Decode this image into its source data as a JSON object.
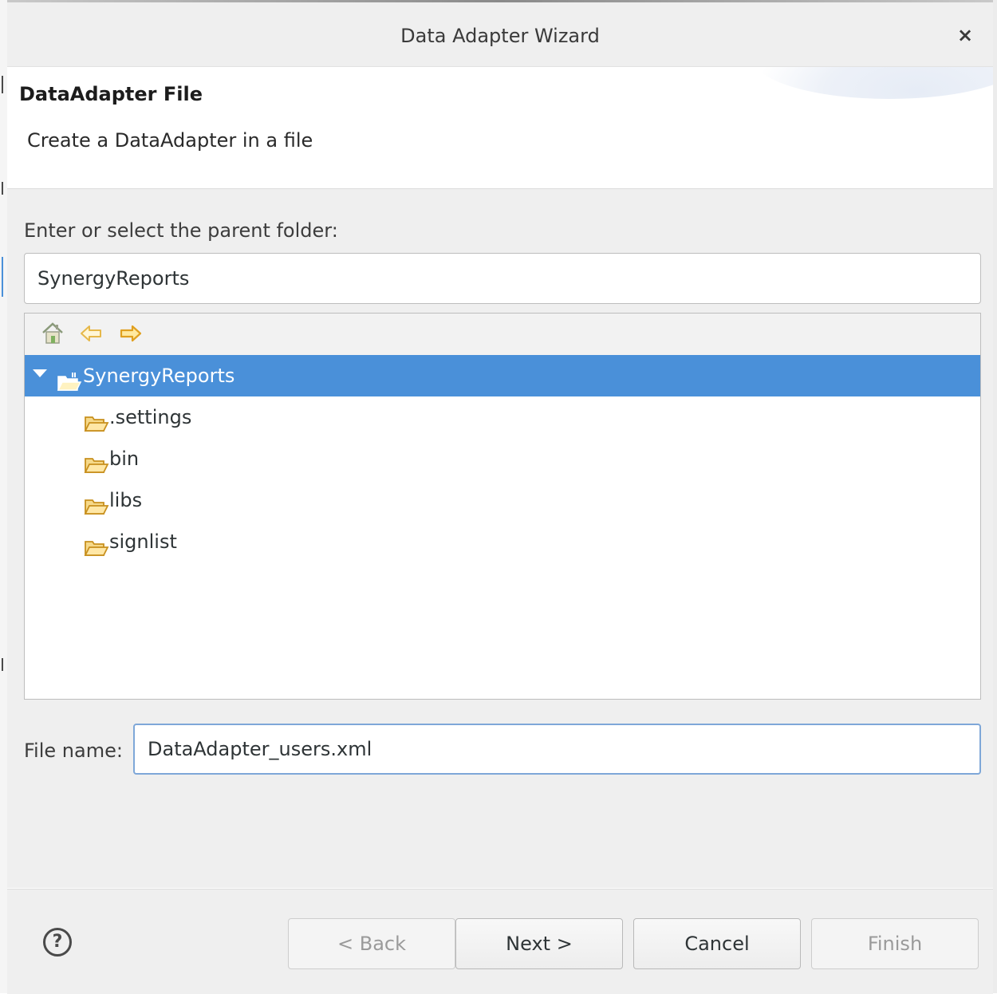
{
  "window": {
    "title": "Data Adapter Wizard",
    "close_glyph": "×"
  },
  "banner": {
    "heading": "DataAdapter File",
    "description": "Create a DataAdapter in a file"
  },
  "folder": {
    "label": "Enter or select the parent folder:",
    "value": "SynergyReports"
  },
  "tree": {
    "toolbar": [
      "home-icon",
      "back-arrow-icon",
      "forward-arrow-icon"
    ],
    "root": {
      "label": "SynergyReports",
      "expanded": true,
      "selected": true
    },
    "children": [
      {
        "label": ".settings"
      },
      {
        "label": "bin"
      },
      {
        "label": "libs"
      },
      {
        "label": "signlist"
      }
    ]
  },
  "file": {
    "label": "File name:",
    "value": "DataAdapter_users.xml"
  },
  "buttons": {
    "help": "?",
    "back": "< Back",
    "next": "Next >",
    "cancel": "Cancel",
    "finish": "Finish"
  },
  "colors": {
    "selection": "#4a90d9",
    "focus_border": "#7ea7d8",
    "folder_icon": "#e0a030"
  }
}
